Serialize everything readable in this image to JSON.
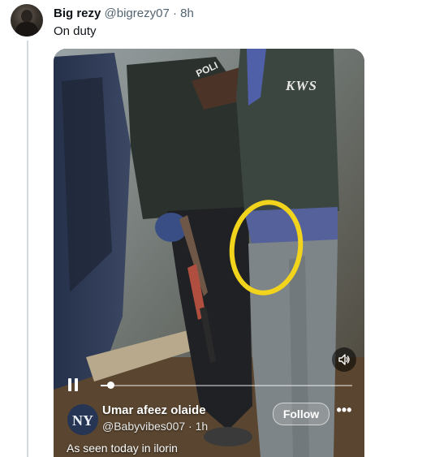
{
  "tweet": {
    "author_name": "Big rezy",
    "author_handle": "@bigrezy07",
    "separator": "·",
    "time": "8h",
    "text": "On duty"
  },
  "video": {
    "embed_author_name": "Umar afeez olaide",
    "embed_author_handle": "@Babyvibes007 · 1h",
    "follow_label": "Follow",
    "more_label": "•••",
    "caption": "As seen today in ilorin",
    "vest_text": "KWS",
    "progress": 0.04,
    "controls": {
      "play_state_icon": "pause-icon",
      "sound_icon": "speaker-icon"
    }
  },
  "colors": {
    "text_primary": "#0f1419",
    "text_secondary": "#536471",
    "thread_line": "#cfd9de",
    "highlight_circle": "#f2d41c"
  }
}
